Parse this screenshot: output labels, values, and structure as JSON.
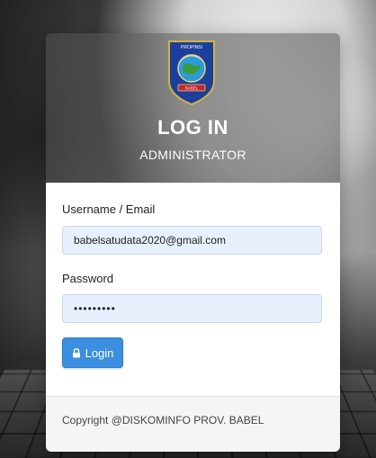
{
  "header": {
    "logo_text_top": "PROPINSI",
    "logo_text_ribbon": "BABEL",
    "title": "LOG IN",
    "subtitle": "ADMINISTRATOR"
  },
  "form": {
    "username_label": "Username / Email",
    "username_value": "babelsatudata2020@gmail.com",
    "password_label": "Password",
    "password_value": "•••••••••",
    "login_button_label": "Login"
  },
  "footer": {
    "copyright": "Copyright @DISKOMINFO PROV. BABEL"
  },
  "colors": {
    "button": "#3b8ee0",
    "input_bg": "#e8f0fe",
    "header_overlay": "#555555"
  }
}
